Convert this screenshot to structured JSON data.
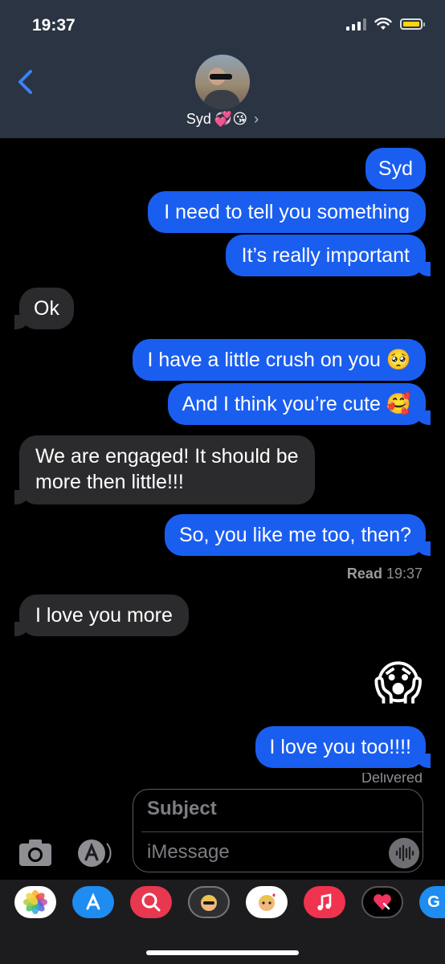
{
  "status_bar": {
    "time": "19:37"
  },
  "header": {
    "contact_name": "Syd",
    "contact_emojis": "💞😘",
    "chevron": "›"
  },
  "messages": [
    {
      "dir": "out",
      "text": "Syd"
    },
    {
      "dir": "out",
      "text": "I need to tell you something"
    },
    {
      "dir": "out",
      "text": "It’s really important"
    },
    {
      "dir": "in",
      "text": "Ok"
    },
    {
      "dir": "out",
      "text": "I have a little crush on you 🥺"
    },
    {
      "dir": "out",
      "text": "And I think you’re cute 🥰"
    },
    {
      "dir": "in",
      "text": "We are engaged! It should be",
      "text2": "more then little!!!"
    },
    {
      "dir": "out",
      "text": "So, you like me too, then?"
    },
    {
      "dir": "in",
      "text": "I love you more"
    },
    {
      "dir": "out",
      "text": "😱"
    },
    {
      "dir": "out",
      "text": "I love you too!!!!"
    }
  ],
  "read_receipt": {
    "label": "Read",
    "time": "19:37"
  },
  "delivered_label": "Delivered",
  "compose": {
    "subject_placeholder": "Subject",
    "message_placeholder": "iMessage"
  },
  "icons": {
    "back": "chevron-left-icon",
    "camera": "camera-icon",
    "apps": "app-store-icon",
    "audio": "waveform-icon"
  },
  "app_drawer": [
    {
      "name": "photos-app-icon"
    },
    {
      "name": "app-store-app-icon"
    },
    {
      "name": "search-images-app-icon"
    },
    {
      "name": "memoji-app-icon"
    },
    {
      "name": "memoji-stickers-app-icon"
    },
    {
      "name": "music-app-icon"
    },
    {
      "name": "digital-touch-app-icon"
    },
    {
      "name": "g-app-icon",
      "label": "G"
    }
  ],
  "colors": {
    "header_bg": "#2b3442",
    "outgoing_bubble": "#1a5ef0",
    "incoming_bubble": "#2b2b2d",
    "accent": "#3b82f6"
  }
}
